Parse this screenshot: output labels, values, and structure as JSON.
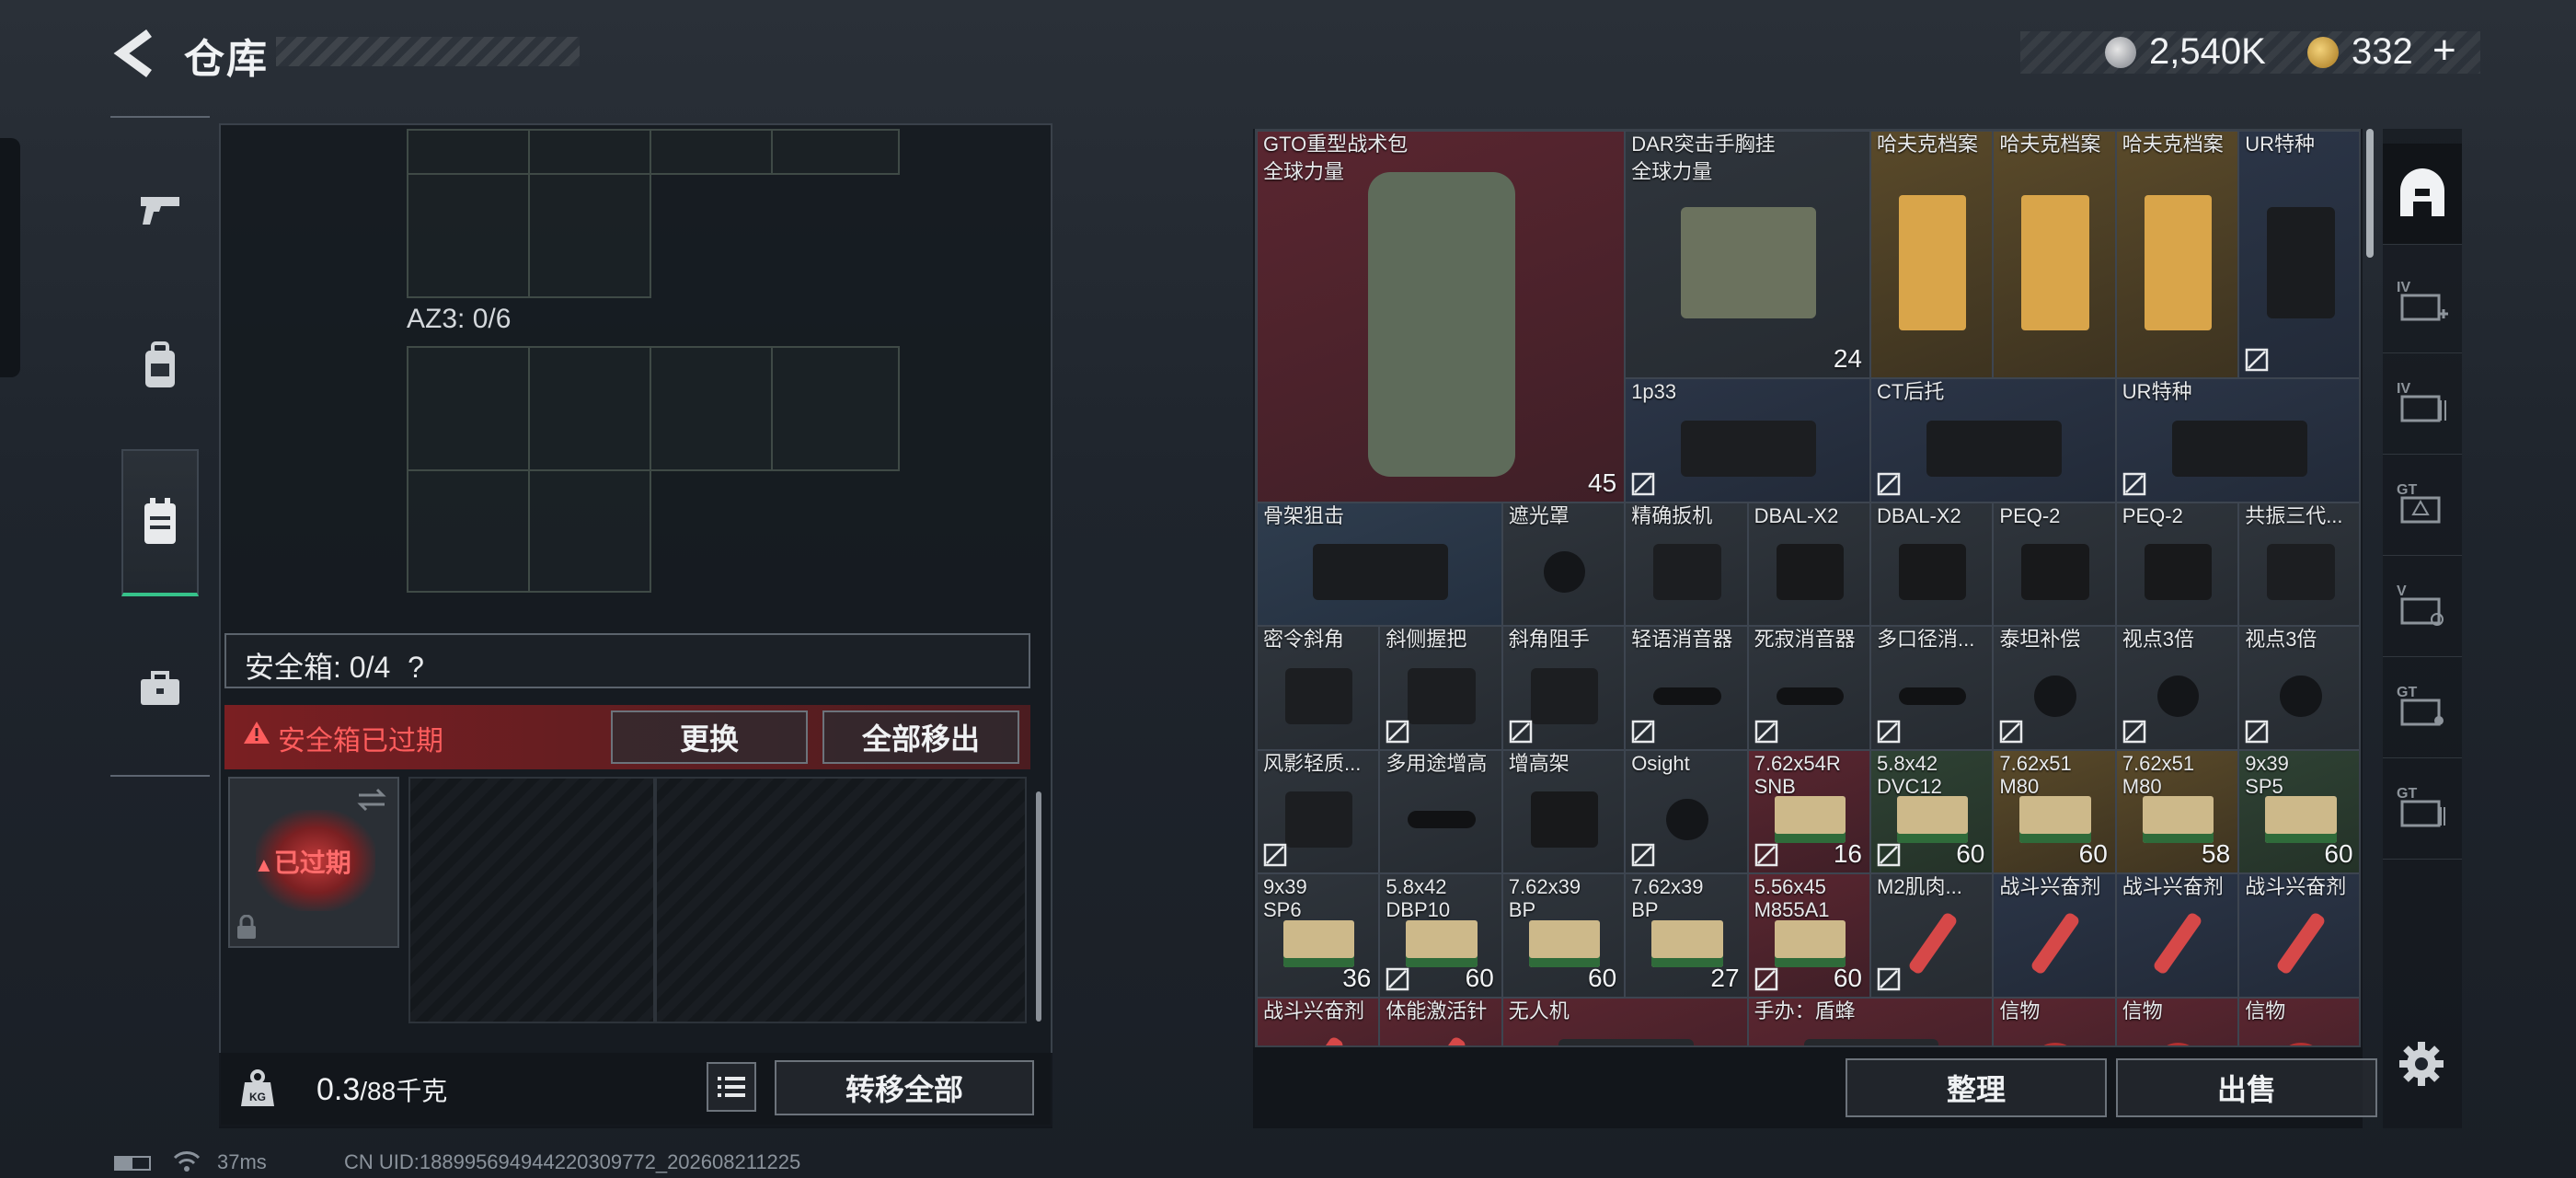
{
  "header": {
    "title": "仓库",
    "currency_silver": "2,540K",
    "currency_gold": "332",
    "add_symbol": "+"
  },
  "left_nav": {
    "items": [
      "pistol-icon",
      "backpack-icon",
      "chest-rig-icon",
      "briefcase-icon"
    ],
    "active_index": 2
  },
  "left_panel": {
    "az_label": "AZ3: 0/6",
    "safe_box_label": "安全箱: 0/4",
    "safe_box_help": "?",
    "expired_warning": "安全箱已过期",
    "swap_button": "更换",
    "move_all_button": "全部移出",
    "case_expired_badge": "已过期",
    "weight_current": "0.3",
    "weight_capacity": "/88千克",
    "transfer_all_button": "转移全部"
  },
  "status_bar": {
    "ping": "37ms",
    "uid": "CN UID:188995694944220309772_202608211225"
  },
  "right_panel": {
    "sort_button": "整理",
    "sell_button": "出售",
    "items": [
      {
        "name": "GTO重型战术包",
        "sub": "全球力量",
        "count": "45",
        "bg": "red"
      },
      {
        "name": "DAR突击手胸挂",
        "sub": "全球力量",
        "count": "24",
        "bg": "gray"
      },
      {
        "name": "哈夫克档案",
        "sub": "",
        "count": "",
        "bg": "gold"
      },
      {
        "name": "哈夫克档案",
        "sub": "",
        "count": "",
        "bg": "gold"
      },
      {
        "name": "哈夫克档案",
        "sub": "",
        "count": "",
        "bg": "gold"
      },
      {
        "name": "UR特种",
        "sub": "",
        "count": "",
        "bg": "blue"
      },
      {
        "name": "1p33",
        "sub": "",
        "count": "",
        "bg": "blue"
      },
      {
        "name": "CT后托",
        "sub": "",
        "count": "",
        "bg": "blue"
      },
      {
        "name": "UR特种",
        "sub": "",
        "count": "",
        "bg": "blue"
      },
      {
        "name": "骨架狙击",
        "sub": "",
        "count": "",
        "bg": "steel"
      },
      {
        "name": "遮光罩",
        "sub": "",
        "count": "",
        "bg": "gray"
      },
      {
        "name": "精确扳机",
        "sub": "",
        "count": "",
        "bg": "gray"
      },
      {
        "name": "DBAL-X2",
        "sub": "",
        "count": "",
        "bg": "gray"
      },
      {
        "name": "DBAL-X2",
        "sub": "",
        "count": "",
        "bg": "gray"
      },
      {
        "name": "PEQ-2",
        "sub": "",
        "count": "",
        "bg": "gray"
      },
      {
        "name": "PEQ-2",
        "sub": "",
        "count": "",
        "bg": "gray"
      },
      {
        "name": "共振三代...",
        "sub": "",
        "count": "",
        "bg": "gray"
      },
      {
        "name": "密令斜角",
        "sub": "",
        "count": "",
        "bg": "gray"
      },
      {
        "name": "斜侧握把",
        "sub": "",
        "count": "",
        "bg": "gray"
      },
      {
        "name": "斜角阻手",
        "sub": "",
        "count": "",
        "bg": "gray"
      },
      {
        "name": "轻语消音器",
        "sub": "",
        "count": "",
        "bg": "gray"
      },
      {
        "name": "死寂消音器",
        "sub": "",
        "count": "",
        "bg": "gray"
      },
      {
        "name": "多口径消...",
        "sub": "",
        "count": "",
        "bg": "gray"
      },
      {
        "name": "泰坦补偿",
        "sub": "",
        "count": "",
        "bg": "gray"
      },
      {
        "name": "视点3倍",
        "sub": "",
        "count": "",
        "bg": "gray"
      },
      {
        "name": "视点3倍",
        "sub": "",
        "count": "",
        "bg": "gray"
      },
      {
        "name": "风影轻质...",
        "sub": "",
        "count": "",
        "bg": "gray"
      },
      {
        "name": "多用途增高",
        "sub": "",
        "count": "",
        "bg": "gray"
      },
      {
        "name": "增高架",
        "sub": "",
        "count": "",
        "bg": "gray"
      },
      {
        "name": "Osight",
        "sub": "",
        "count": "",
        "bg": "gray"
      },
      {
        "name": "7.62x54R",
        "sub": "SNB",
        "count": "16",
        "bg": "red"
      },
      {
        "name": "5.8x42",
        "sub": "DVC12",
        "count": "60",
        "bg": "green"
      },
      {
        "name": "7.62x51",
        "sub": "M80",
        "count": "60",
        "bg": "gold"
      },
      {
        "name": "7.62x51",
        "sub": "M80",
        "count": "58",
        "bg": "gold"
      },
      {
        "name": "9x39",
        "sub": "SP5",
        "count": "60",
        "bg": "green"
      },
      {
        "name": "9x39",
        "sub": "SP6",
        "count": "36",
        "bg": "gray"
      },
      {
        "name": "5.8x42",
        "sub": "DBP10",
        "count": "60",
        "bg": "gray"
      },
      {
        "name": "7.62x39",
        "sub": "BP",
        "count": "60",
        "bg": "gray"
      },
      {
        "name": "7.62x39",
        "sub": "BP",
        "count": "27",
        "bg": "gray"
      },
      {
        "name": "5.56x45",
        "sub": "M855A1",
        "count": "60",
        "bg": "red"
      },
      {
        "name": "M2肌肉...",
        "sub": "",
        "count": "",
        "bg": "gray"
      },
      {
        "name": "战斗兴奋剂",
        "sub": "",
        "count": "",
        "bg": "blue"
      },
      {
        "name": "战斗兴奋剂",
        "sub": "",
        "count": "",
        "bg": "blue"
      },
      {
        "name": "战斗兴奋剂",
        "sub": "",
        "count": "",
        "bg": "blue"
      },
      {
        "name": "战斗兴奋剂",
        "sub": "",
        "count": "",
        "bg": "red"
      },
      {
        "name": "体能激活针",
        "sub": "",
        "count": "",
        "bg": "red"
      },
      {
        "name": "无人机",
        "sub": "",
        "count": "",
        "bg": "red"
      },
      {
        "name": "手办：盾蜂",
        "sub": "",
        "count": "",
        "bg": "red"
      },
      {
        "name": "信物",
        "sub": "",
        "count": "",
        "bg": "red"
      },
      {
        "name": "信物",
        "sub": "",
        "count": "",
        "bg": "red"
      },
      {
        "name": "信物",
        "sub": "",
        "count": "",
        "bg": "red"
      }
    ]
  },
  "right_nav": {
    "items": [
      "helmet-icon",
      "container-iv-plus-icon",
      "container-iv-icon",
      "container-gt-icon",
      "container-v-icon",
      "container-gt-2-icon",
      "container-gt-3-icon"
    ]
  }
}
